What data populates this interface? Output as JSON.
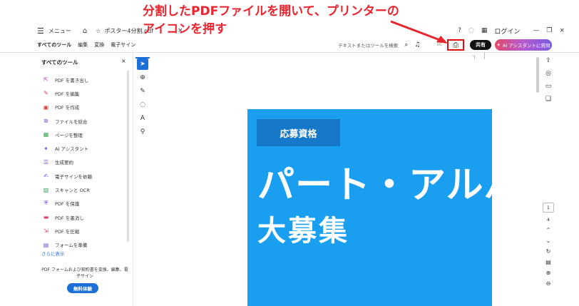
{
  "annotation": {
    "line1": "分割したPDFファイルを開いて、プリンターの",
    "line2": "アイコンを押す",
    "color": "#e8242e"
  },
  "titlebar": {
    "menu_label": "メニュー",
    "tab_title": "ポスター4分割.pdf",
    "login": "ログイン"
  },
  "toolbar": {
    "tabs": [
      "すべてのツール",
      "編集",
      "変換",
      "電子サイン"
    ],
    "search_text": "テキストまたはツールを検索",
    "share_label": "共有",
    "ai_label": "AI アシスタントに質問"
  },
  "left_panel": {
    "title": "すべてのツール",
    "items": [
      {
        "label": "PDF を書き出し",
        "icon": "export-pdf-icon",
        "color": "#c43bb0"
      },
      {
        "label": "PDF を編集",
        "icon": "edit-pdf-icon",
        "color": "#d83b68"
      },
      {
        "label": "PDF を作成",
        "icon": "create-pdf-icon",
        "color": "#e0433a"
      },
      {
        "label": "ファイルを結合",
        "icon": "combine-files-icon",
        "color": "#7b4ee0"
      },
      {
        "label": "ページを整理",
        "icon": "organize-pages-icon",
        "color": "#3aa85a"
      },
      {
        "label": "AI アシスタント",
        "icon": "ai-assistant-icon",
        "color": "#7b4ee0"
      },
      {
        "label": "生成要約",
        "icon": "summary-icon",
        "color": "#7b4ee0"
      },
      {
        "label": "電子サインを依頼",
        "icon": "request-esign-icon",
        "color": "#7b4ee0"
      },
      {
        "label": "スキャンと OCR",
        "icon": "scan-ocr-icon",
        "color": "#3aa85a"
      },
      {
        "label": "PDF を保護",
        "icon": "protect-pdf-icon",
        "color": "#7b4ee0"
      },
      {
        "label": "PDF を墨消し",
        "icon": "redact-pdf-icon",
        "color": "#d83b68"
      },
      {
        "label": "PDF を圧縮",
        "icon": "compress-pdf-icon",
        "color": "#d83b68"
      },
      {
        "label": "フォームを準備",
        "icon": "prepare-form-icon",
        "color": "#7b4ee0"
      }
    ],
    "more_label": "さらに表示",
    "description": "PDF フォームおよび契約書を変換、編集、電子サイン",
    "trial_label": "無料体験"
  },
  "poster": {
    "badge": "応募資格",
    "line1": "パート・アルバ",
    "line2": "大募集",
    "background": "#1a9ff0"
  },
  "page_nav": {
    "current": "1",
    "total": "4"
  }
}
